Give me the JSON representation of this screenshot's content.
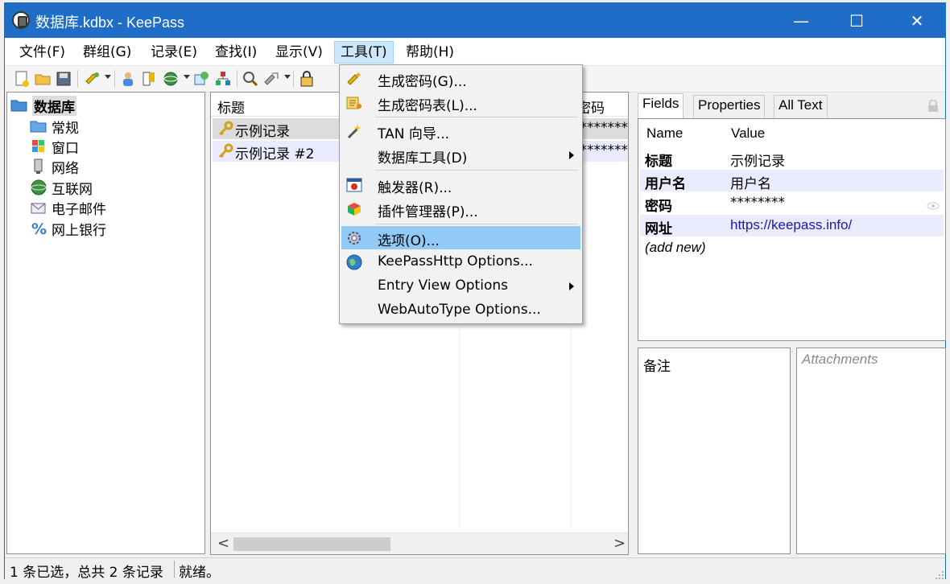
{
  "window": {
    "title": "数据库.kdbx - KeePass",
    "controls": {
      "minimize": "—",
      "maximize": "☐",
      "close": "✕"
    }
  },
  "menubar": {
    "items": [
      {
        "label": "文件(F)"
      },
      {
        "label": "群组(G)"
      },
      {
        "label": "记录(E)"
      },
      {
        "label": "查找(I)"
      },
      {
        "label": "显示(V)"
      },
      {
        "label": "工具(T)"
      },
      {
        "label": "帮助(H)"
      }
    ]
  },
  "tree": {
    "root": "数据库",
    "groups": [
      "常规",
      "窗口",
      "网络",
      "互联网",
      "电子邮件",
      "网上银行"
    ]
  },
  "entry_list": {
    "columns": [
      "标题",
      "密码"
    ],
    "rows": [
      {
        "title": "示例记录",
        "password": "********"
      },
      {
        "title": "示例记录 #2",
        "password": "********"
      }
    ],
    "scroll_left": "<",
    "scroll_right": ">"
  },
  "tools_menu": {
    "items": [
      {
        "label": "生成密码(G)..."
      },
      {
        "label": "生成密码表(L)..."
      },
      {
        "label": "TAN 向导..."
      },
      {
        "label": "数据库工具(D)"
      },
      {
        "label": "触发器(R)..."
      },
      {
        "label": "插件管理器(P)..."
      },
      {
        "label": "选项(O)..."
      },
      {
        "label": "KeePassHttp Options..."
      },
      {
        "label": "Entry View Options"
      },
      {
        "label": "WebAutoType Options..."
      }
    ]
  },
  "details": {
    "tabs": [
      "Fields",
      "Properties",
      "All Text"
    ],
    "header": {
      "name": "Name",
      "value": "Value"
    },
    "fields": [
      {
        "name": "标题",
        "value": "示例记录"
      },
      {
        "name": "用户名",
        "value": "用户名"
      },
      {
        "name": "密码",
        "value": "********"
      },
      {
        "name": "网址",
        "value": "https://keepass.info/"
      }
    ],
    "add_new": "(add new)",
    "notes_label": "备注",
    "attachments_label": "Attachments",
    "link_color": "#1a1aa6"
  },
  "statusbar": {
    "selection": "1 条已选，总共 2 条记录",
    "state": "就绪。"
  }
}
